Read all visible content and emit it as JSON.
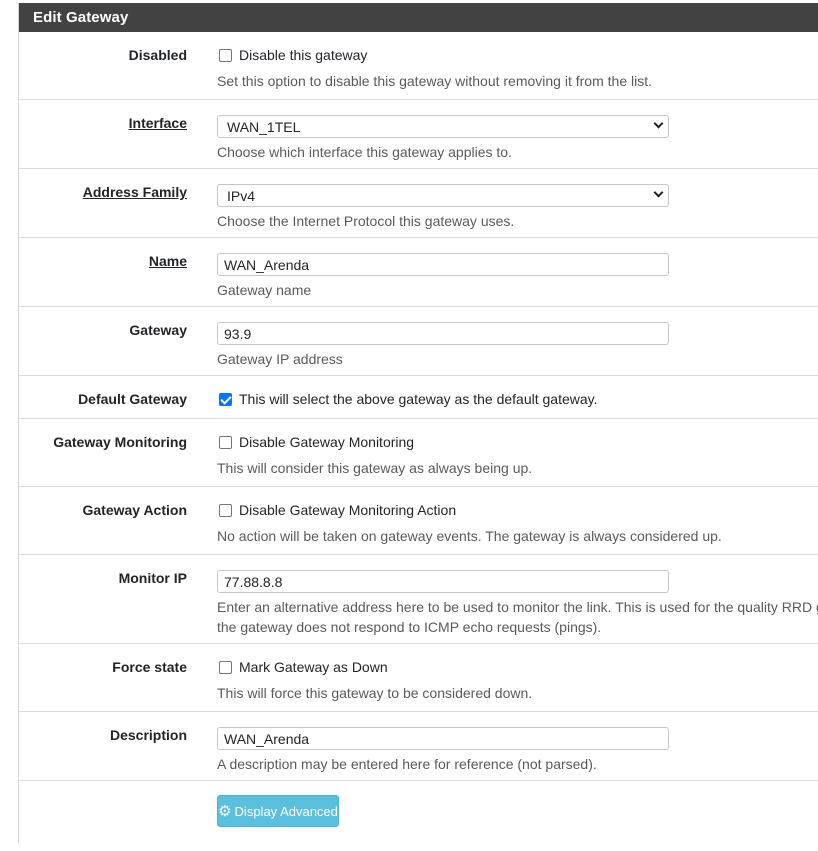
{
  "panel": {
    "title": "Edit Gateway"
  },
  "disabled": {
    "label": "Disabled",
    "checkbox_label": "Disable this gateway",
    "checked": false,
    "help": "Set this option to disable this gateway without removing it from the list."
  },
  "interface": {
    "label": "Interface",
    "value": "WAN_1TEL",
    "help": "Choose which interface this gateway applies to."
  },
  "address_family": {
    "label": "Address Family",
    "value": "IPv4",
    "help": "Choose the Internet Protocol this gateway uses."
  },
  "name": {
    "label": "Name",
    "value": "WAN_Arenda",
    "help": "Gateway name"
  },
  "gateway": {
    "label": "Gateway",
    "value": "93.9",
    "help": "Gateway IP address"
  },
  "default_gateway": {
    "label": "Default Gateway",
    "checkbox_label": "This will select the above gateway as the default gateway.",
    "checked": true
  },
  "gateway_monitoring": {
    "label": "Gateway Monitoring",
    "checkbox_label": "Disable Gateway Monitoring",
    "checked": false,
    "help": "This will consider this gateway as always being up."
  },
  "gateway_action": {
    "label": "Gateway Action",
    "checkbox_label": "Disable Gateway Monitoring Action",
    "checked": false,
    "help": "No action will be taken on gateway events. The gateway is always considered up."
  },
  "monitor_ip": {
    "label": "Monitor IP",
    "value": "77.88.8.8",
    "help_line1": "Enter an alternative address here to be used to monitor the link. This is used for the quality RRD gr",
    "help_line2": "the gateway does not respond to ICMP echo requests (pings)."
  },
  "force_state": {
    "label": "Force state",
    "checkbox_label": "Mark Gateway as Down",
    "checked": false,
    "help": "This will force this gateway to be considered down."
  },
  "description": {
    "label": "Description",
    "value": "WAN_Arenda",
    "help": "A description may be entered here for reference (not parsed)."
  },
  "display_advanced": {
    "label": "Display Advanced",
    "icon": "gear-icon"
  }
}
